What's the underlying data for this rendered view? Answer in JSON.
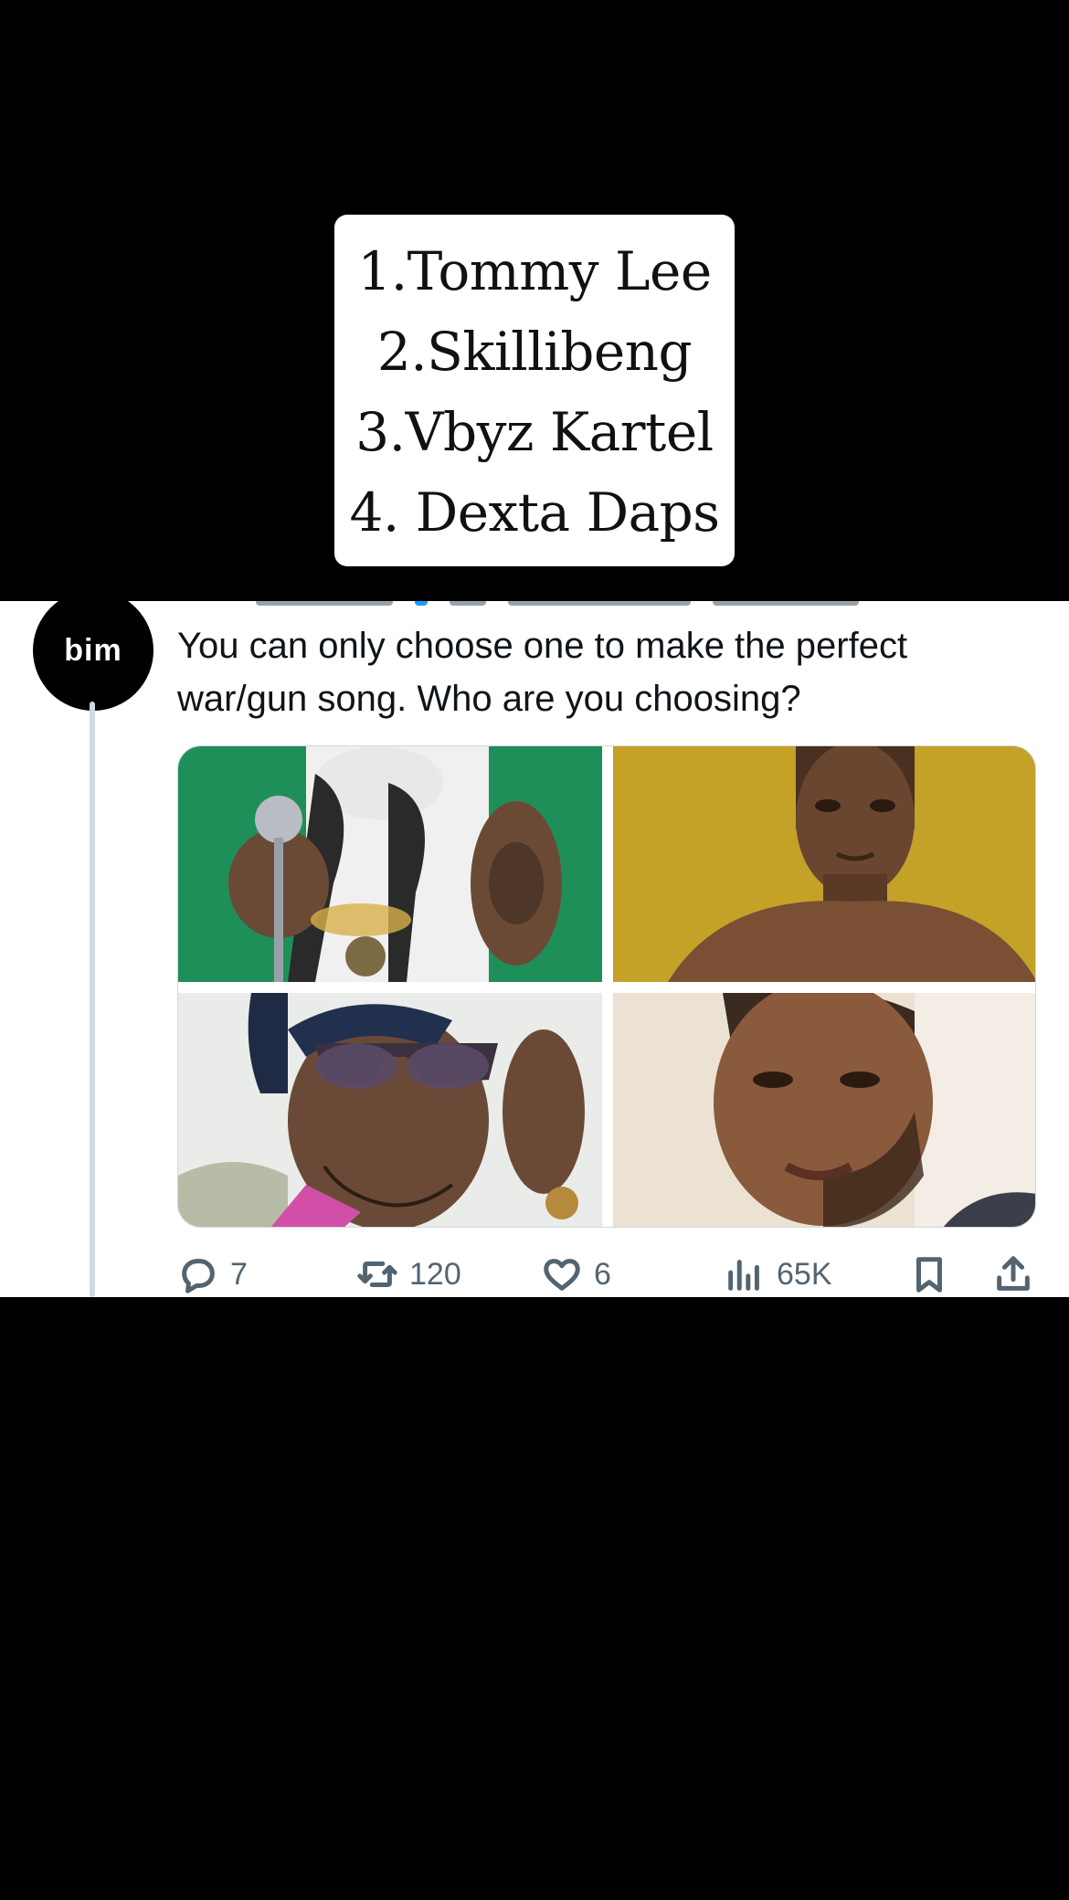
{
  "overlay": {
    "lines": [
      "1.Tommy Lee",
      "2.Skillibeng",
      "3.Vbyz Kartel",
      "4. Dexta Daps"
    ]
  },
  "tweet": {
    "avatar_text": "bim",
    "text": "You can only choose one to make the perfect war/gun song. Who are you choosing?",
    "media": [
      {
        "name": "photo-1",
        "background": "#1f8f5a"
      },
      {
        "name": "photo-2",
        "background": "#c9a92c"
      },
      {
        "name": "photo-3",
        "background": "#e9ece8"
      },
      {
        "name": "photo-4",
        "background": "#ece2d4"
      }
    ],
    "actions": {
      "replies": "7",
      "reposts": "120",
      "likes": "6",
      "views": "65K"
    }
  },
  "icons": {
    "reply": "reply-icon",
    "repost": "repost-icon",
    "like": "heart-icon",
    "views": "views-icon",
    "bookmark": "bookmark-icon",
    "share": "share-icon"
  }
}
